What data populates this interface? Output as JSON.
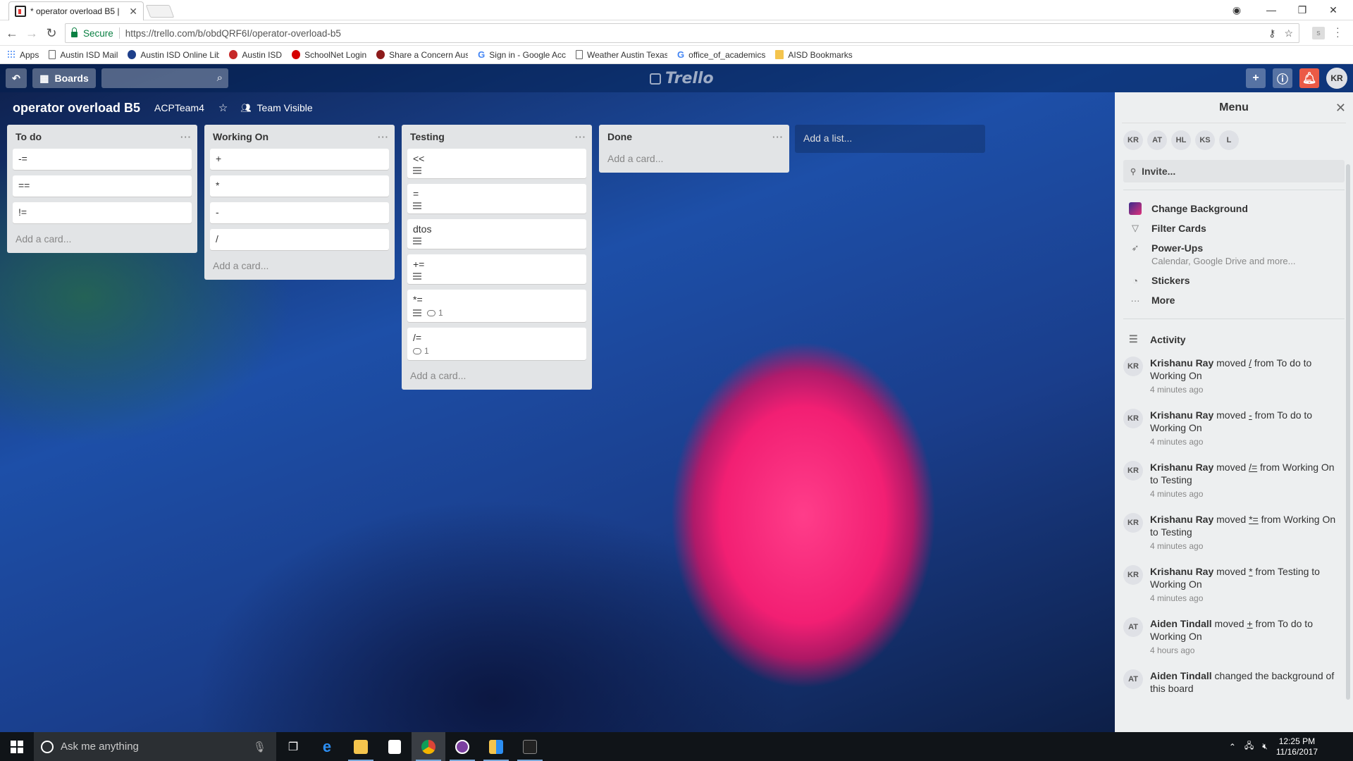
{
  "browser": {
    "tab_title": "* operator overload B5 |",
    "secure_label": "Secure",
    "url": "https://trello.com/b/obdQRF6I/operator-overload-b5",
    "bookmarks": [
      {
        "label": "Apps",
        "icon": "apps-grid-icon"
      },
      {
        "label": "Austin ISD Mail",
        "icon": "page-icon"
      },
      {
        "label": "Austin ISD Online Lib",
        "icon": "globe-icon"
      },
      {
        "label": "Austin ISD",
        "icon": "apple-icon"
      },
      {
        "label": "SchoolNet Login",
        "icon": "schoolnet-icon"
      },
      {
        "label": "Share a Concern Aus",
        "icon": "aisd-icon"
      },
      {
        "label": "Sign in - Google Acc",
        "icon": "google-icon"
      },
      {
        "label": "Weather Austin Texas",
        "icon": "page-icon"
      },
      {
        "label": "office_of_academics",
        "icon": "google-icon"
      },
      {
        "label": "AISD Bookmarks",
        "icon": "folder-icon"
      }
    ]
  },
  "topbar": {
    "boards_label": "Boards",
    "logo_text": "Trello",
    "user_initials": "KR"
  },
  "board": {
    "name": "operator overload B5",
    "team": "ACPTeam4",
    "visibility": "Team Visible"
  },
  "lists": [
    {
      "title": "To do",
      "cards": [
        {
          "text": "-="
        },
        {
          "text": "=="
        },
        {
          "text": "!="
        }
      ],
      "add_card": "Add a card..."
    },
    {
      "title": "Working On",
      "cards": [
        {
          "text": "+"
        },
        {
          "text": "*"
        },
        {
          "text": "-"
        },
        {
          "text": "/"
        }
      ],
      "add_card": "Add a card..."
    },
    {
      "title": "Testing",
      "cards": [
        {
          "text": "<<",
          "desc": true
        },
        {
          "text": "=",
          "desc": true
        },
        {
          "text": "dtos",
          "desc": true
        },
        {
          "text": "+=",
          "desc": true
        },
        {
          "text": "*=",
          "desc": true,
          "comments": "1"
        },
        {
          "text": "/=",
          "comments": "1"
        }
      ],
      "add_card": "Add a card..."
    },
    {
      "title": "Done",
      "cards": [],
      "add_card": "Add a card..."
    }
  ],
  "add_list": "Add a list...",
  "menu": {
    "title": "Menu",
    "members": [
      "KR",
      "AT",
      "HL",
      "KS",
      "L"
    ],
    "invite": "Invite...",
    "items": [
      {
        "label": "Change Background"
      },
      {
        "label": "Filter Cards"
      },
      {
        "label": "Power-Ups",
        "sub": "Calendar, Google Drive and more..."
      },
      {
        "label": "Stickers"
      },
      {
        "label": "More"
      }
    ],
    "activity_title": "Activity",
    "activity": [
      {
        "initials": "KR",
        "user": "Krishanu Ray",
        "verb": "moved",
        "item": "/",
        "rest": "from To do to Working On",
        "time": "4 minutes ago"
      },
      {
        "initials": "KR",
        "user": "Krishanu Ray",
        "verb": "moved",
        "item": "-",
        "rest": "from To do to Working On",
        "time": "4 minutes ago"
      },
      {
        "initials": "KR",
        "user": "Krishanu Ray",
        "verb": "moved",
        "item": "/=",
        "rest": "from Working On to Testing",
        "time": "4 minutes ago"
      },
      {
        "initials": "KR",
        "user": "Krishanu Ray",
        "verb": "moved",
        "item": "*=",
        "rest": "from Working On to Testing",
        "time": "4 minutes ago"
      },
      {
        "initials": "KR",
        "user": "Krishanu Ray",
        "verb": "moved",
        "item": "*",
        "rest": "from Testing to Working On",
        "time": "4 minutes ago"
      },
      {
        "initials": "AT",
        "user": "Aiden Tindall",
        "verb": "moved",
        "item": "+",
        "rest": "from To do to Working On",
        "time": "4 hours ago"
      },
      {
        "initials": "AT",
        "user": "Aiden Tindall",
        "verb": "changed the background of this board",
        "item": "",
        "rest": "",
        "time": ""
      }
    ]
  },
  "taskbar": {
    "search_placeholder": "Ask me anything",
    "time": "12:25 PM",
    "date": "11/16/2017"
  },
  "colors": {
    "board_accent": "#1d4fa8",
    "notification": "#eb5a46"
  }
}
